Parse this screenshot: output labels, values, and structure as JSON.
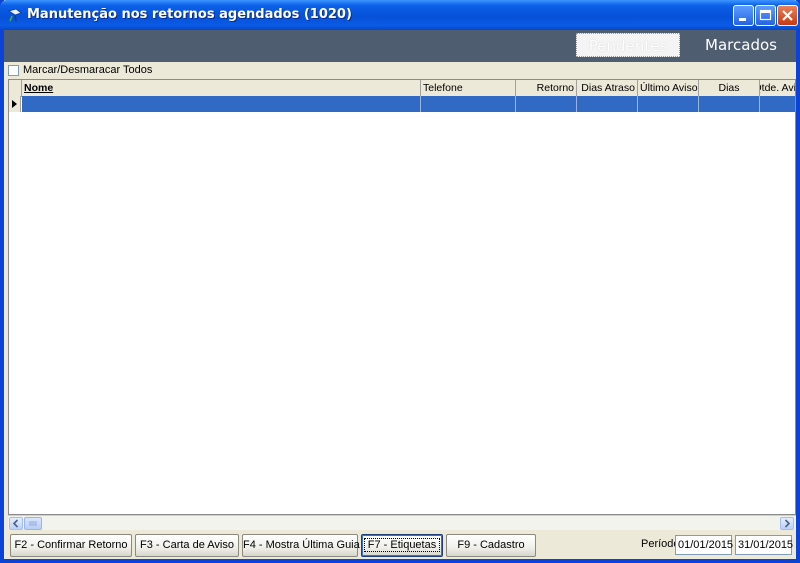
{
  "window": {
    "title": "Manutenção nos retornos agendados (1020)",
    "icon": "app-icon"
  },
  "tabs": [
    {
      "label": "Pendentes",
      "state": "inactive"
    },
    {
      "label": "Marcados",
      "state": "active"
    }
  ],
  "select_all": {
    "label": "Marcar/Desmaracar Todos",
    "checked": false
  },
  "grid": {
    "columns": [
      "Nome",
      "Telefone",
      "Retorno",
      "Dias Atraso",
      "Último Aviso",
      "Dias",
      "Qtde. Aviso"
    ],
    "rows": [
      [
        "",
        "",
        "",
        "",
        "",
        "",
        ""
      ]
    ],
    "selected_row": 0
  },
  "buttons": {
    "confirmar": "F2 - Confirmar Retorno",
    "carta": "F3 - Carta de Aviso",
    "guia": "F4 - Mostra Última Guia",
    "etiquetas": "F7 - Etiquetas",
    "cadastro": "F9 - Cadastro"
  },
  "periodo": {
    "label": "Período",
    "start": "01/01/2015",
    "end": "31/01/2015"
  },
  "colors": {
    "title_bar": "#0A5BE6",
    "tab_bar": "#4E5D70",
    "selection": "#316AC5"
  }
}
